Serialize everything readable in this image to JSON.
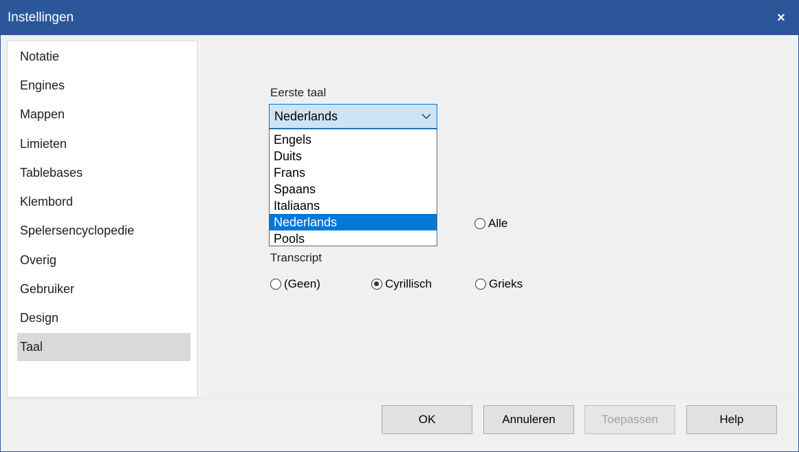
{
  "window": {
    "title": "Instellingen",
    "close_icon": "×"
  },
  "sidebar": {
    "items": [
      {
        "label": "Notatie"
      },
      {
        "label": "Engines"
      },
      {
        "label": "Mappen"
      },
      {
        "label": "Limieten"
      },
      {
        "label": "Tablebases"
      },
      {
        "label": "Klembord"
      },
      {
        "label": "Spelersencyclopedie"
      },
      {
        "label": "Overig"
      },
      {
        "label": "Gebruiker"
      },
      {
        "label": "Design"
      },
      {
        "label": "Taal"
      }
    ],
    "active": "Taal"
  },
  "language": {
    "first_language_label": "Eerste taal",
    "selected": "Nederlands",
    "options": [
      "Engels",
      "Duits",
      "Frans",
      "Spaans",
      "Italiaans",
      "Nederlands",
      "Pools"
    ],
    "alle_label": "Alle",
    "alle_checked": false
  },
  "transcript": {
    "label": "Transcript",
    "options": [
      {
        "label": "(Geen)",
        "checked": false
      },
      {
        "label": "Cyrillisch",
        "checked": true
      },
      {
        "label": "Grieks",
        "checked": false
      }
    ]
  },
  "buttons": {
    "ok": "OK",
    "cancel": "Annuleren",
    "apply": "Toepassen",
    "help": "Help",
    "apply_enabled": false
  },
  "colors": {
    "titlebar": "#2b579a",
    "selection": "#0078d7",
    "sidebar_active": "#d9d9d9"
  }
}
